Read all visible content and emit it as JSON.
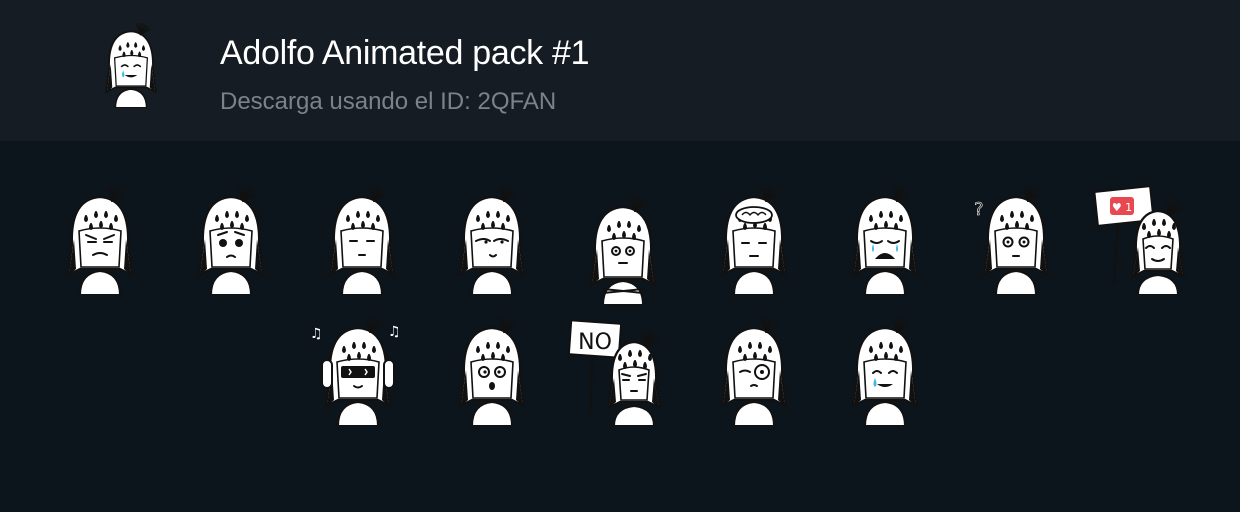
{
  "pack": {
    "title": "Adolfo Animated pack #1",
    "subtitle": "Descarga usando el ID: 2QFAN",
    "icon": "adolfo-happy-tear"
  },
  "stickers": [
    {
      "name": "angry",
      "row": 1
    },
    {
      "name": "sad-puppy-eyes",
      "row": 1
    },
    {
      "name": "blank-stare",
      "row": 1
    },
    {
      "name": "smug",
      "row": 1
    },
    {
      "name": "arms-crossed",
      "row": 1
    },
    {
      "name": "brain-exposed",
      "row": 1
    },
    {
      "name": "crying",
      "row": 1
    },
    {
      "name": "confused-shrug",
      "row": 1
    },
    {
      "name": "heart-like-sign",
      "row": 1,
      "sign_text": "1"
    },
    {
      "name": "headphones-sunglasses",
      "row": 2
    },
    {
      "name": "surprised",
      "row": 2
    },
    {
      "name": "no-sign",
      "row": 2,
      "sign_text": "NO"
    },
    {
      "name": "monocle",
      "row": 2
    },
    {
      "name": "happy-tear",
      "row": 2
    }
  ],
  "colors": {
    "background": "#0d151c",
    "header": "#151c23",
    "title": "#ffffff",
    "subtitle": "#7d8287",
    "tear": "#3fb7e8",
    "heart_sign": "#e8484f"
  }
}
